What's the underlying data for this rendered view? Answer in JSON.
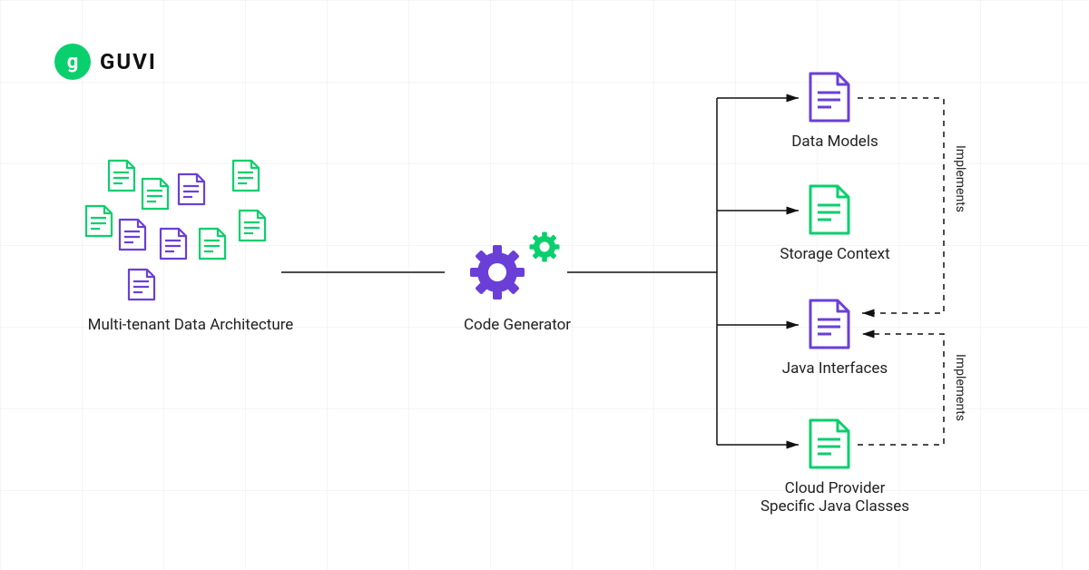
{
  "brand": {
    "name": "GUVI",
    "mark": "g"
  },
  "colors": {
    "green": "#0ACF6D",
    "purple": "#6A3FD8",
    "black": "#111111"
  },
  "nodes": {
    "left": {
      "label": "Multi-tenant Data Architecture"
    },
    "center": {
      "label": "Code Generator"
    },
    "right": [
      {
        "label": "Data Models",
        "color": "purple"
      },
      {
        "label": "Storage Context",
        "color": "green"
      },
      {
        "label": "Java Interfaces",
        "color": "purple"
      },
      {
        "label": "Cloud Provider\nSpecific Java Classes",
        "color": "green"
      }
    ]
  },
  "edges": {
    "implements_top": "Implements",
    "implements_bottom": "Implements"
  }
}
